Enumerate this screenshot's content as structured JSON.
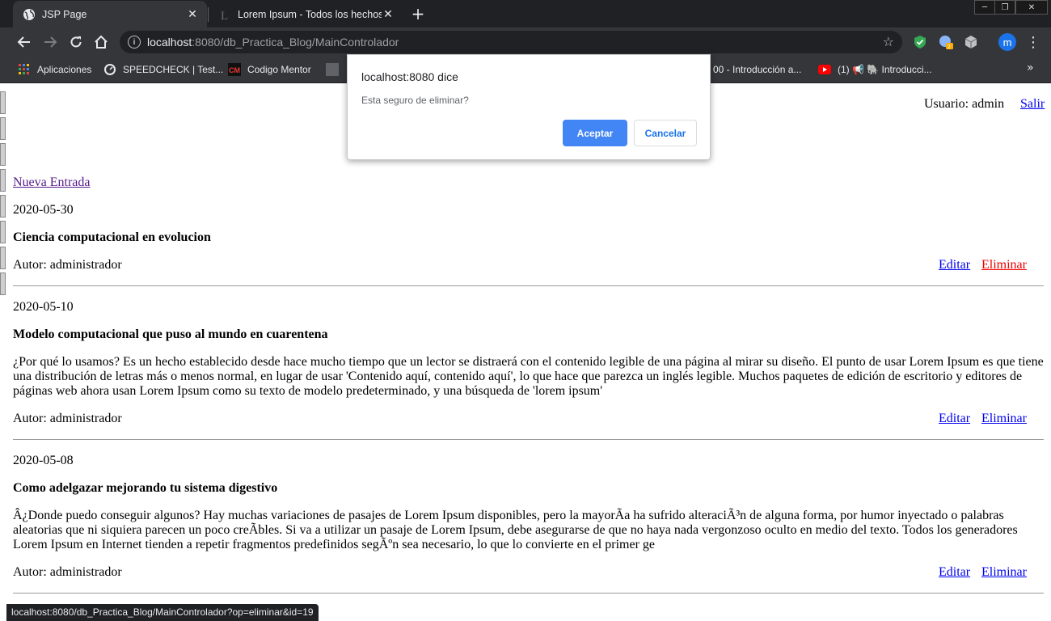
{
  "browser": {
    "tabs": [
      {
        "title": "JSP Page",
        "active": true
      },
      {
        "title": "Lorem Ipsum - Todos los hechos",
        "active": false
      }
    ],
    "url_host": "localhost",
    "url_rest": ":8080/db_Practica_Blog/MainControlador",
    "bookmarks": [
      {
        "label": "Aplicaciones"
      },
      {
        "label": "SPEEDCHECK | Test..."
      },
      {
        "label": "Codigo Mentor"
      },
      {
        "label": "00 - Introducción a..."
      },
      {
        "label": "(1) 📢 🐘 Introducci..."
      }
    ],
    "avatar_letter": "m",
    "extension_badge": "2"
  },
  "header": {
    "user_label": "Usuario: admin",
    "logout_label": "Salir"
  },
  "new_entry_label": "Nueva Entrada",
  "entries": [
    {
      "date": "2020-05-30",
      "title": "Ciencia computacional en evolucion",
      "body": "",
      "author": "Autor: administrador",
      "edit_label": "Editar",
      "delete_label": "Eliminar"
    },
    {
      "date": "2020-05-10",
      "title": "Modelo computacional que puso al mundo en cuarentena",
      "body": "¿Por qué lo usamos? Es un hecho establecido desde hace mucho tiempo que un lector se distraerá con el contenido legible de una página al mirar su diseño. El punto de usar Lorem Ipsum es que tiene una distribución de letras más o menos normal, en lugar de usar 'Contenido aquí, contenido aquí', lo que hace que parezca un inglés legible. Muchos paquetes de edición de escritorio y editores de páginas web ahora usan Lorem Ipsum como su texto de modelo predeterminado, y una búsqueda de 'lorem ipsum'",
      "author": "Autor: administrador",
      "edit_label": "Editar",
      "delete_label": "Eliminar"
    },
    {
      "date": "2020-05-08",
      "title": "Como adelgazar mejorando tu sistema digestivo",
      "body": "Â¿Donde puedo conseguir algunos? Hay muchas variaciones de pasajes de Lorem Ipsum disponibles, pero la mayorÃa ha sufrido alteraciÃ³n de alguna forma, por humor inyectado o palabras aleatorias que ni siquiera parecen un poco creÃbles. Si va a utilizar un pasaje de Lorem Ipsum, debe asegurarse de que no haya nada vergonzoso oculto en medio del texto. Todos los generadores Lorem Ipsum en Internet tienden a repetir fragmentos predefinidos segÃºn sea necesario, lo que lo convierte en el primer ge",
      "author": "Autor: administrador",
      "edit_label": "Editar",
      "delete_label": "Eliminar"
    }
  ],
  "dialog": {
    "title": "localhost:8080 dice",
    "message": "Esta seguro de eliminar?",
    "ok_label": "Aceptar",
    "cancel_label": "Cancelar"
  },
  "status_bar": "localhost:8080/db_Practica_Blog/MainControlador?op=eliminar&id=19",
  "colors": {
    "chrome_dark": "#202124",
    "chrome_toolbar": "#35363a",
    "link": "#0000ee",
    "link_visited": "#551a8b",
    "link_hover_delete": "#ee0000",
    "dialog_primary": "#4285f4"
  }
}
